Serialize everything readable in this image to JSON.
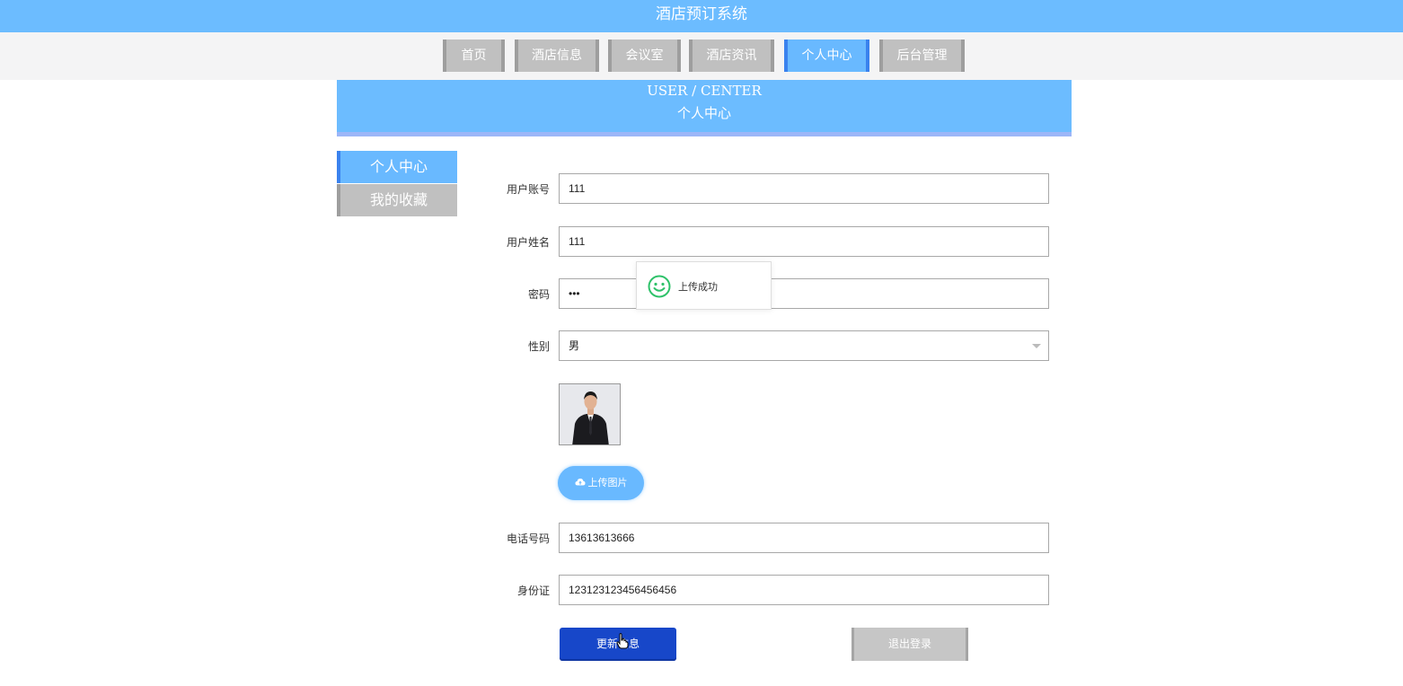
{
  "app": {
    "title": "酒店预订系统"
  },
  "nav": {
    "items": [
      {
        "label": "首页"
      },
      {
        "label": "酒店信息"
      },
      {
        "label": "会议室"
      },
      {
        "label": "酒店资讯"
      },
      {
        "label": "个人中心",
        "active": true
      },
      {
        "label": "后台管理"
      }
    ]
  },
  "banner": {
    "en": "USER / CENTER",
    "cn": "个人中心"
  },
  "sidebar": {
    "items": [
      {
        "label": "个人中心",
        "active": true
      },
      {
        "label": "我的收藏"
      }
    ]
  },
  "form": {
    "account": {
      "label": "用户账号",
      "value": "111"
    },
    "name": {
      "label": "用户姓名",
      "value": "111"
    },
    "password": {
      "label": "密码",
      "value": "•••"
    },
    "gender": {
      "label": "性别",
      "value": "男"
    },
    "upload_label": "上传图片",
    "phone": {
      "label": "电话号码",
      "value": "13613613666"
    },
    "idcard": {
      "label": "身份证",
      "value": "123123123456456456"
    },
    "update_label": "更新信息",
    "logout_label": "退出登录"
  },
  "toast": {
    "message": "上传成功",
    "icon": "smile-icon"
  },
  "colors": {
    "primary": "#6cbcff",
    "accent": "#3a82ee",
    "update_button": "#1747c9",
    "inactive": "#c0c0c0"
  }
}
